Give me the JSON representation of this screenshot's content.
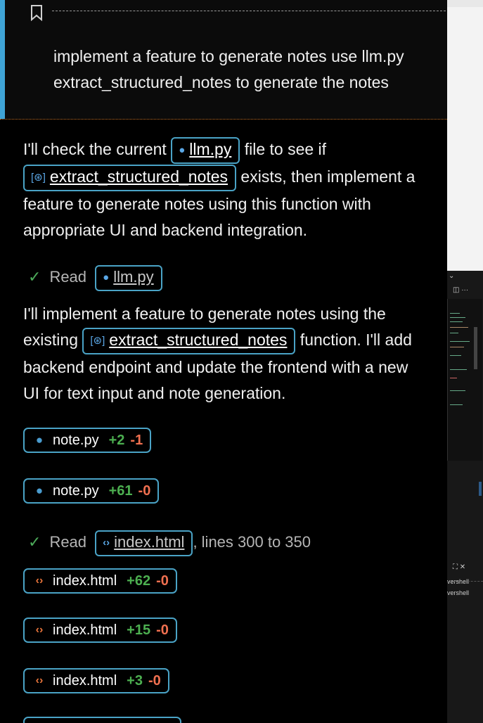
{
  "user_message": {
    "line1": "implement a feature to generate notes use llm.py",
    "line2": "extract_structured_notes to generate the notes"
  },
  "reply1": {
    "text_a": "I'll check the current ",
    "chip_llm": "llm.py",
    "text_b": " file to see if",
    "chip_fn": "extract_structured_notes",
    "text_c": " exists, then implement a",
    "line3": "feature to generate notes using this function with",
    "line4": "appropriate UI and backend integration."
  },
  "read1": {
    "label": "Read",
    "file": "llm.py"
  },
  "reply2": {
    "line1": "I'll implement a feature to generate notes using the",
    "text_a": "existing ",
    "chip_fn": "extract_structured_notes",
    "text_b": " function. I'll add",
    "line3": "backend endpoint and update the frontend with a new",
    "line4": "UI for text input and note generation."
  },
  "edits1": [
    {
      "file": "note.py",
      "added": "+2",
      "removed": "-1"
    },
    {
      "file": "note.py",
      "added": "+61",
      "removed": "-0"
    }
  ],
  "read2": {
    "label": "Read",
    "file": "index.html",
    "suffix": ", lines 300 to 350"
  },
  "edits2": [
    {
      "file": "index.html",
      "added": "+62",
      "removed": "-0"
    },
    {
      "file": "index.html",
      "added": "+15",
      "removed": "-0"
    },
    {
      "file": "index.html",
      "added": "+3",
      "removed": "-0"
    }
  ],
  "background_window": {
    "terminal_line1": "vershell",
    "terminal_line2": "vershell"
  },
  "colors": {
    "accent": "#3fa4d6",
    "chip_border": "#4aa3c6",
    "added": "#4caf50",
    "removed": "#f07050",
    "check": "#4caa5a"
  }
}
